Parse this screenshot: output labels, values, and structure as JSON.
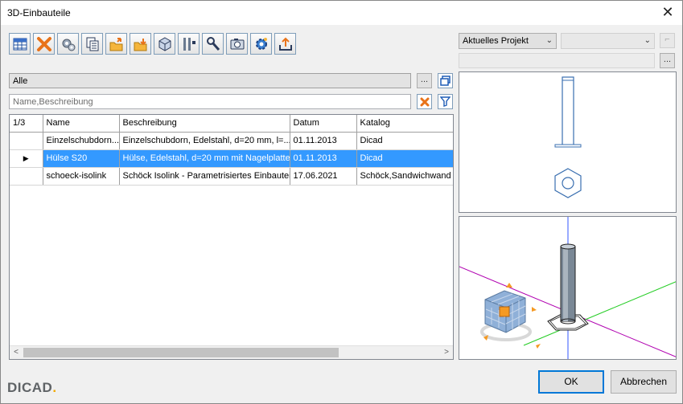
{
  "window": {
    "title": "3D-Einbauteile"
  },
  "toolbar": {
    "buttons": [
      "table-view",
      "delete",
      "parts-settings",
      "copy",
      "export",
      "import",
      "box",
      "tools",
      "key",
      "camera",
      "gear",
      "upload"
    ]
  },
  "filter": {
    "category_value": "Alle",
    "browse_label": "...",
    "search_placeholder": "Name,Beschreibung"
  },
  "grid": {
    "counter": "1/3",
    "columns": [
      "Name",
      "Beschreibung",
      "Datum",
      "Katalog"
    ],
    "rows": [
      {
        "name": "Einzelschubdorn...",
        "description": "Einzelschubdorn, Edelstahl, d=20 mm, l=...",
        "date": "01.11.2013",
        "catalog": "Dicad"
      },
      {
        "name": "Hülse S20",
        "description": "Hülse, Edelstahl, d=20 mm mit Nagelplatte",
        "date": "01.11.2013",
        "catalog": "Dicad"
      },
      {
        "name": "schoeck-isolink",
        "description": "Schöck Isolink - Parametrisiertes Einbauteil",
        "date": "17.06.2021",
        "catalog": "Schöck,Sandwichwand"
      }
    ],
    "selected_row": 1,
    "row_marker": "▶"
  },
  "project": {
    "scope_value": "Aktuelles Projekt",
    "browse_label": "..."
  },
  "footer": {
    "brand": "DICAD",
    "brand_dot": ".",
    "ok_label": "OK",
    "cancel_label": "Abbrechen"
  },
  "colors": {
    "selection": "#3399ff",
    "axis_x": "#b000b0",
    "axis_y": "#22cc22",
    "axis_z": "#3355ff",
    "cube": "#8fb0d8",
    "cube_accent": "#f59a23"
  }
}
